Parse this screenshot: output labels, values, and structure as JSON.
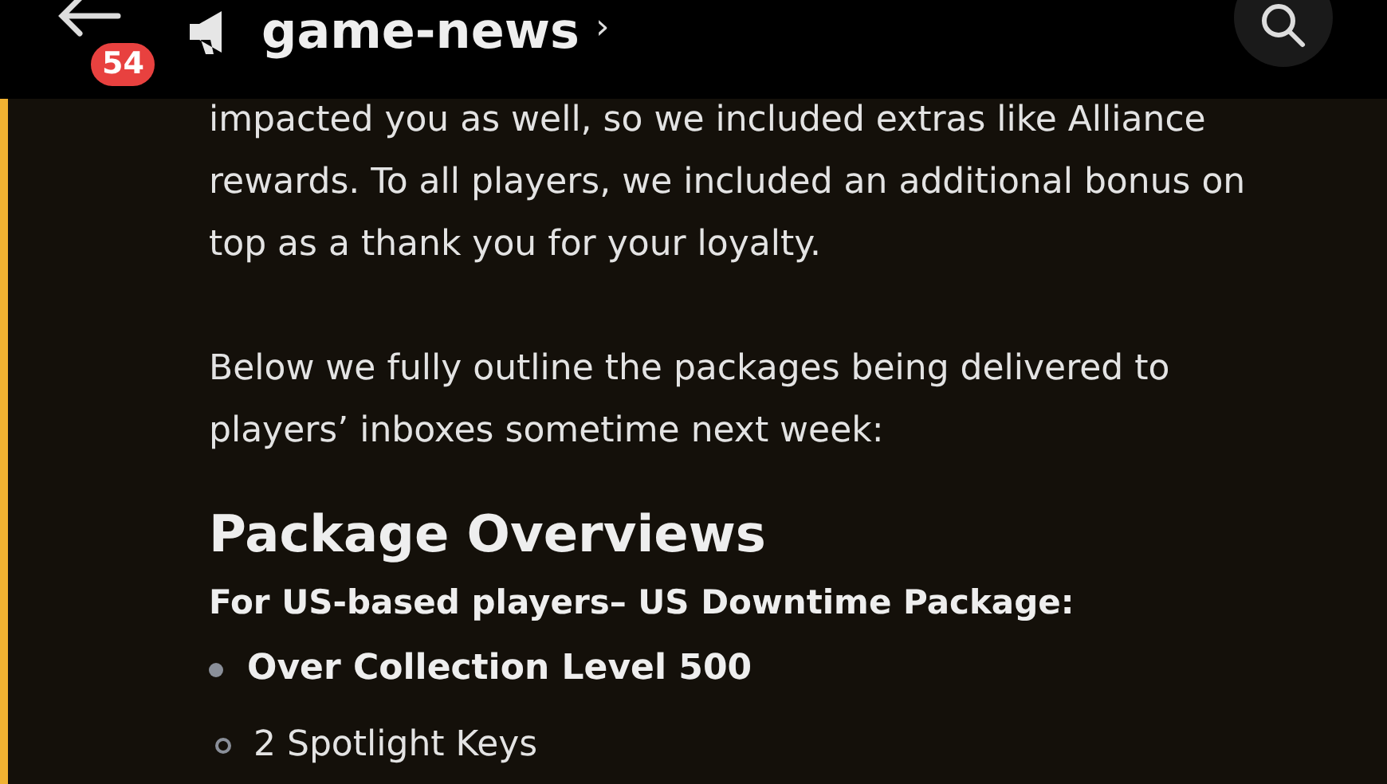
{
  "header": {
    "unread_badge": "54",
    "channel_name": "game-news",
    "chevron": "›"
  },
  "message": {
    "highlighted": true,
    "paragraphs": [
      "impacted you as well, so we included extras like Alliance rewards. To all players, we included an additional bonus on top as a thank you for your loyalty.",
      "Below we fully outline the packages being delivered to players’ inboxes sometime next week:"
    ],
    "heading": "Package Overviews",
    "subheading": "For US-based players– US Downtime Package:",
    "list": [
      {
        "text": "Over Collection Level 500",
        "children": [
          {
            "text": "2 Spotlight Keys"
          }
        ]
      }
    ]
  }
}
